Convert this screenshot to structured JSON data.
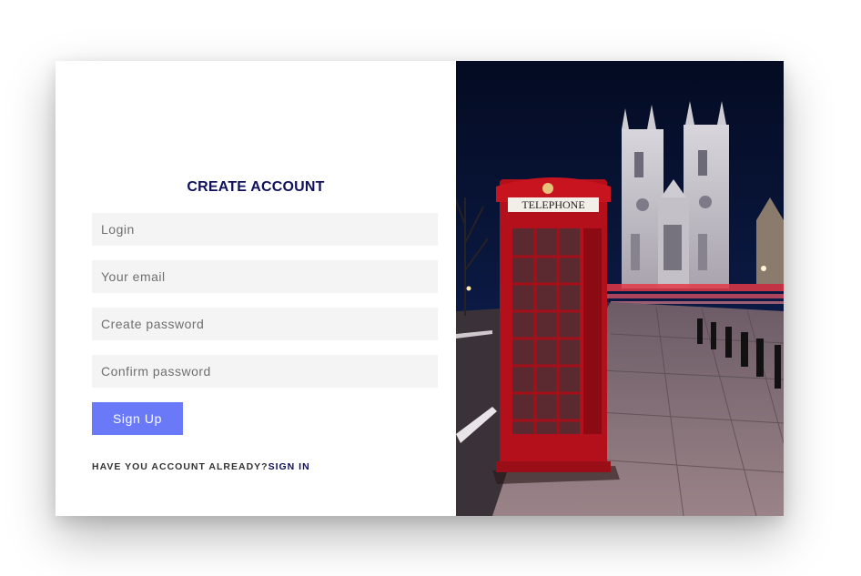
{
  "form": {
    "title": "CREATE ACCOUNT",
    "login_placeholder": "Login",
    "email_placeholder": "Your email",
    "password_placeholder": "Create password",
    "confirm_placeholder": "Confirm password",
    "signup_label": "Sign Up",
    "account_prompt": "HAVE YOU ACCOUNT ALREADY?",
    "signin_label": "SIGN IN"
  },
  "photo": {
    "subject": "red telephone box in front of cathedral at night",
    "booth_sign": "TELEPHONE"
  },
  "colors": {
    "title": "#10105c",
    "button": "#6979f8",
    "input_bg": "#f4f4f4",
    "booth_red": "#c0121c",
    "sky": "#07122e"
  }
}
